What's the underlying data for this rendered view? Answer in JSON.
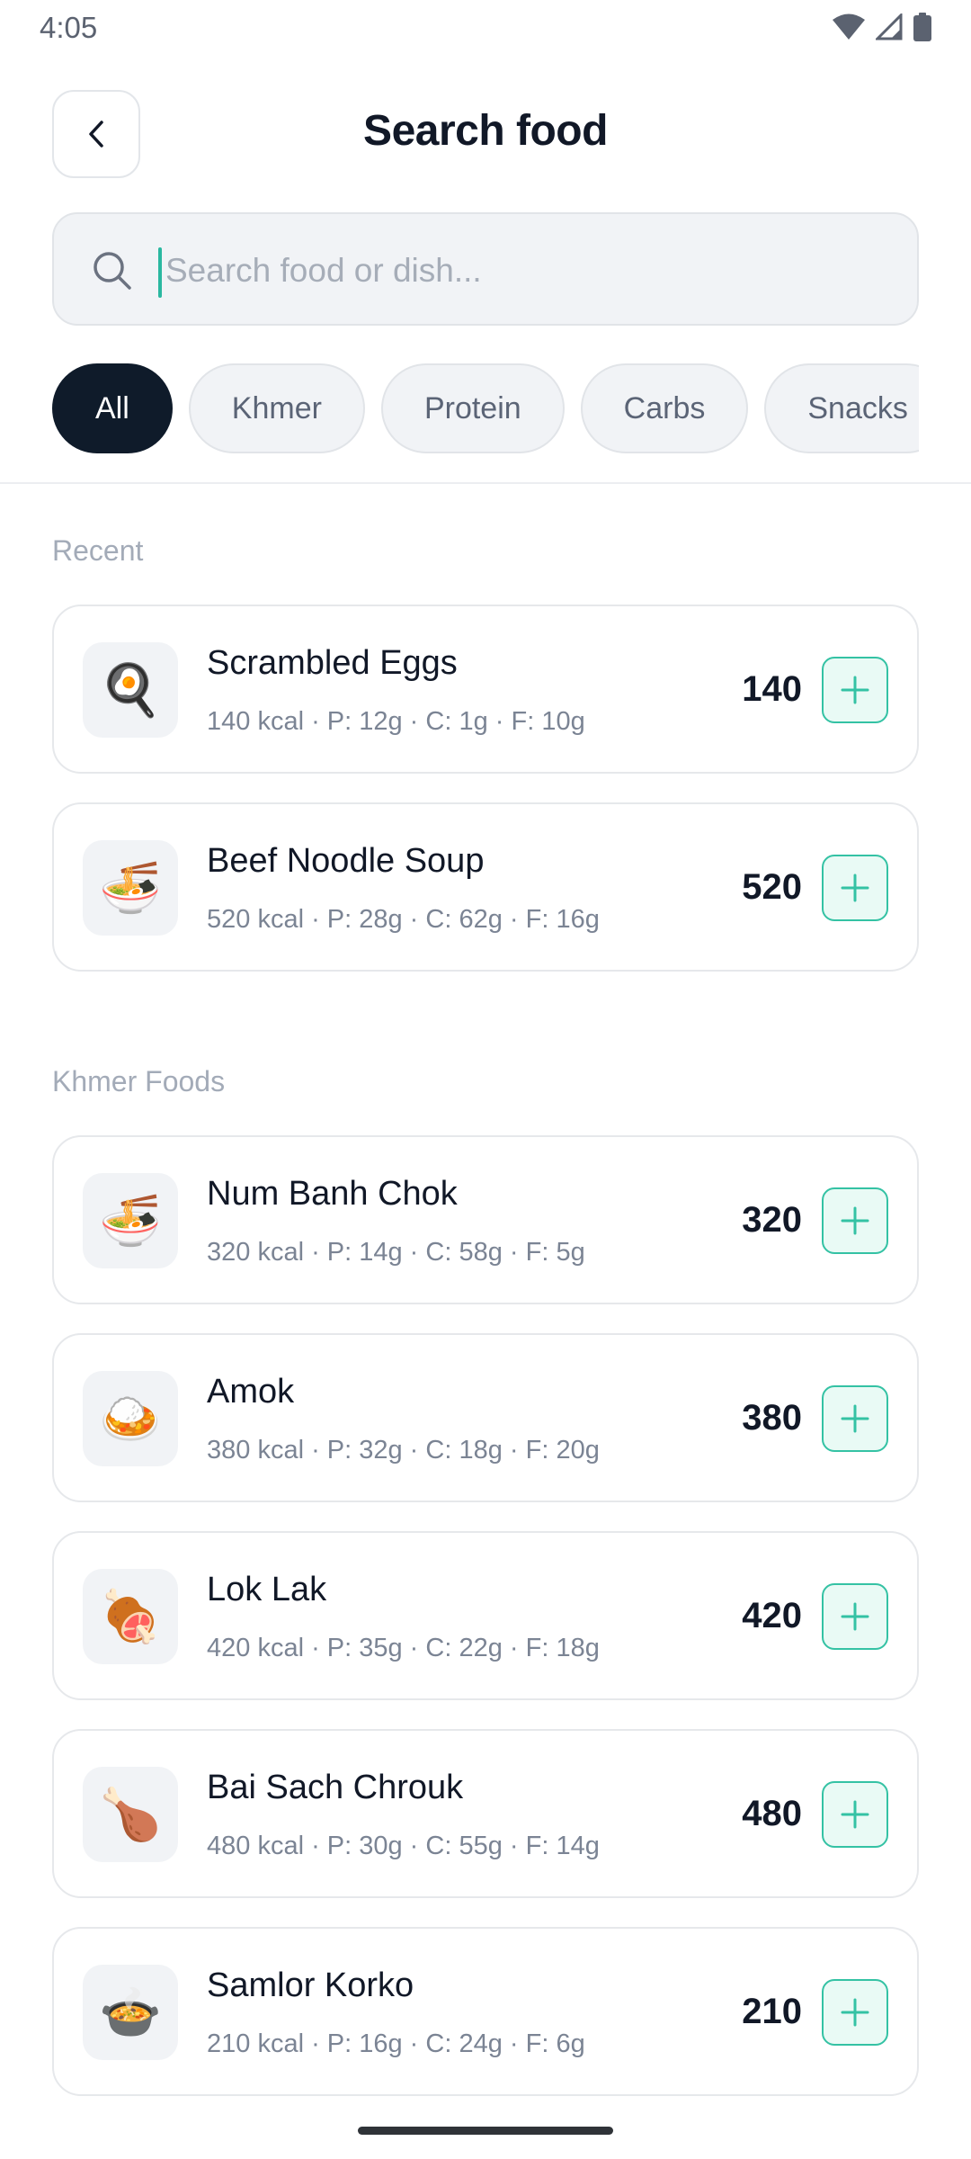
{
  "status_bar": {
    "time": "4:05",
    "icons": [
      "wifi-icon",
      "cellular-signal-icon",
      "battery-icon"
    ]
  },
  "header": {
    "title": "Search food",
    "back_icon": "chevron-left-icon"
  },
  "search": {
    "placeholder": "Search food or dish...",
    "value": "",
    "icon": "search-icon"
  },
  "filters": [
    {
      "label": "All",
      "active": true
    },
    {
      "label": "Khmer",
      "active": false
    },
    {
      "label": "Protein",
      "active": false
    },
    {
      "label": "Carbs",
      "active": false
    },
    {
      "label": "Snacks",
      "active": false
    }
  ],
  "sections": {
    "recent": {
      "title": "Recent",
      "items": [
        {
          "icon": "🍳",
          "icon_name": "frying-pan-egg-icon",
          "name": "Scrambled Eggs",
          "macros": "140 kcal · P: 12g · C: 1g · F: 10g",
          "kcal": "140"
        },
        {
          "icon": "🍜",
          "icon_name": "noodle-bowl-icon",
          "name": "Beef Noodle Soup",
          "macros": "520 kcal · P: 28g · C: 62g · F: 16g",
          "kcal": "520"
        }
      ]
    },
    "khmer": {
      "title": "Khmer Foods",
      "items": [
        {
          "icon": "🍜",
          "icon_name": "noodle-bowl-icon",
          "name": "Num Banh Chok",
          "macros": "320 kcal · P: 14g · C: 58g · F: 5g",
          "kcal": "320"
        },
        {
          "icon": "🍛",
          "icon_name": "curry-rice-icon",
          "name": "Amok",
          "macros": "380 kcal · P: 32g · C: 18g · F: 20g",
          "kcal": "380"
        },
        {
          "icon": "🍖",
          "icon_name": "meat-on-bone-icon",
          "name": "Lok Lak",
          "macros": "420 kcal · P: 35g · C: 22g · F: 18g",
          "kcal": "420"
        },
        {
          "icon": "🍗",
          "icon_name": "poultry-leg-icon",
          "name": "Bai Sach Chrouk",
          "macros": "480 kcal · P: 30g · C: 55g · F: 14g",
          "kcal": "480"
        },
        {
          "icon": "🍲",
          "icon_name": "pot-of-food-icon",
          "name": "Samlor Korko",
          "macros": "210 kcal · P: 16g · C: 24g · F: 6g",
          "kcal": "210"
        }
      ]
    }
  },
  "add_button_icon": "plus-icon",
  "colors": {
    "accent": "#34c2a4",
    "accent_bg": "#e9faf5",
    "active_chip": "#0f1b2a"
  }
}
